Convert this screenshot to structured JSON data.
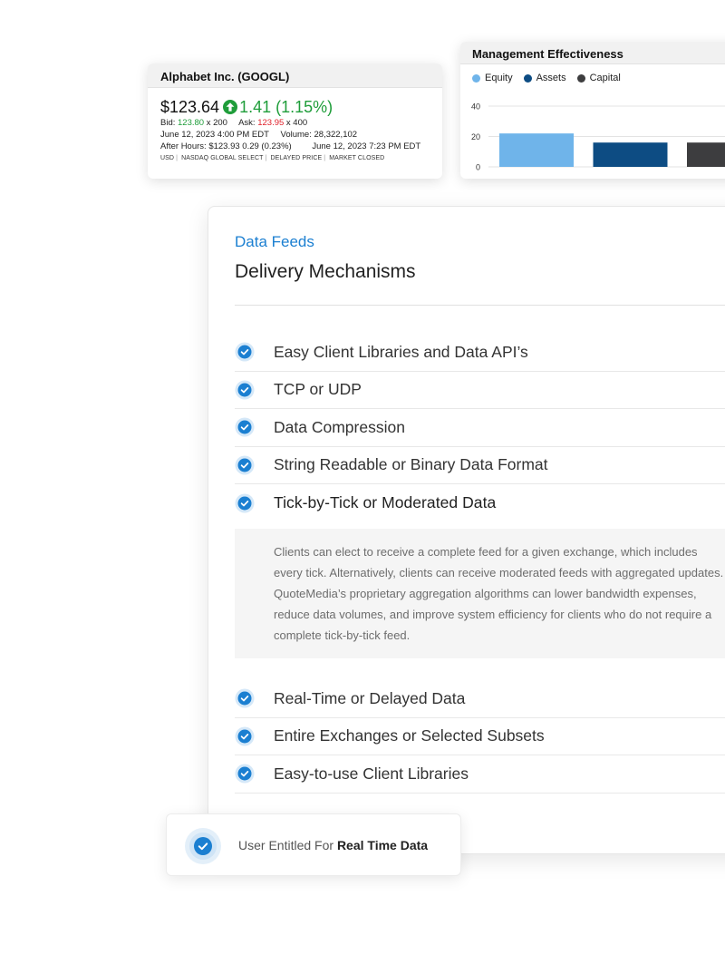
{
  "quote": {
    "title": "Alphabet Inc. (GOOGL)",
    "price": "$123.64",
    "change": "1.41 (1.15%)",
    "bid_label": "Bid:",
    "bid_value": "123.80",
    "bid_size": "x 200",
    "ask_label": "Ask:",
    "ask_value": "123.95",
    "ask_size": "x 400",
    "datetime": "June 12, 2023 4:00 PM EDT",
    "volume": "Volume: 28,322,102",
    "after_hours": "After Hours: $123.93 0.29 (0.23%)",
    "after_hours_time": "June 12, 2023 7:23 PM EDT",
    "tags": [
      "USD",
      "NASDAQ GLOBAL SELECT",
      "DELAYED PRICE",
      "MARKET CLOSED"
    ],
    "colors": {
      "up": "#1f9d3a",
      "down": "#e0202a"
    }
  },
  "chart_card": {
    "title": "Management Effectiveness"
  },
  "chart_data": {
    "type": "bar",
    "title": "Management Effectiveness",
    "categories": [
      "Equity",
      "Assets",
      "Capital"
    ],
    "values": [
      22,
      16,
      16
    ],
    "colors": [
      "#6fb4ea",
      "#0d4c83",
      "#3d3d3f"
    ],
    "ylim": [
      0,
      40
    ],
    "yticks": [
      0,
      20,
      40
    ],
    "legend_position": "top-left",
    "grid": true
  },
  "panel": {
    "eyebrow": "Data Feeds",
    "title": "Delivery Mechanisms",
    "accent": "#1b7fd1",
    "features_top": [
      {
        "label": "Easy Client Libraries and Data API’s",
        "icon": "check-circle-icon"
      },
      {
        "label": "TCP or UDP",
        "icon": "check-circle-icon"
      },
      {
        "label": "Data Compression",
        "icon": "check-circle-icon"
      },
      {
        "label": "String Readable or Binary Data Format",
        "icon": "check-circle-icon"
      },
      {
        "label": "Tick-by-Tick or Moderated Data",
        "icon": "check-circle-icon",
        "expanded": true
      }
    ],
    "detail": "Clients can elect to receive a complete feed for a given exchange, which includes every tick. Alternatively, clients can receive moderated feeds with aggregated updates. QuoteMedia’s proprietary aggregation algorithms can lower bandwidth expenses, reduce data volumes, and improve system efficiency for clients who do not require a complete tick-by-tick feed.",
    "features_bottom": [
      {
        "label": "Real-Time or Delayed Data",
        "icon": "check-circle-icon"
      },
      {
        "label": "Entire Exchanges or Selected Subsets",
        "icon": "check-circle-icon"
      },
      {
        "label": "Easy-to-use Client Libraries",
        "icon": "check-circle-icon"
      }
    ]
  },
  "entitlement": {
    "prefix": "User Entitled For",
    "emphasis": "Real Time Data",
    "icon": "check-circle-icon"
  }
}
